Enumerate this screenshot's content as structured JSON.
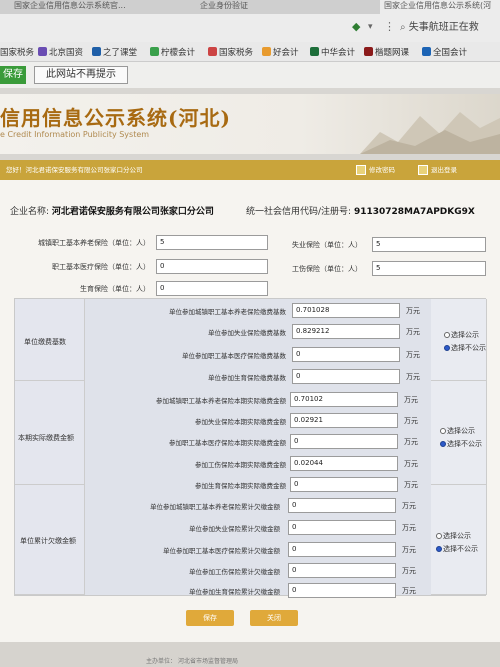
{
  "browser": {
    "tabs": [
      "国家企业信用信息公示系统官...",
      "企业身份验证",
      "国家企业信用信息公示系统(河"
    ],
    "search_text": "失事航班正在救",
    "bookmarks": [
      "国家税务",
      "北京国资",
      "之了课堂",
      "柠檬会计",
      "国家税务",
      "好会计",
      "中华会计",
      "楷题网课",
      "全国会计"
    ]
  },
  "infobar": {
    "save_label": "保存",
    "never_label": "此网站不再提示"
  },
  "site": {
    "title": "信用信息公示系统(河北)",
    "subtitle": "e Credit Information Publicity System",
    "greeting": "您好！河北君诺保安服务有限公司张家口分公司",
    "change_password": "修改密码",
    "logout": "退出登录"
  },
  "company": {
    "name_label": "企业名称:",
    "name": "河北君诺保安服务有限公司张家口分公司",
    "code_label": "统一社会信用代码/注册号:",
    "code": "91130728MA7APDKG9X"
  },
  "insured": {
    "pension_label": "城镇职工基本养老保险（单位：人）",
    "pension": "5",
    "unemployment_label": "失业保险（单位：人）",
    "unemployment": "5",
    "medical_label": "职工基本医疗保险（单位：人）",
    "medical": "0",
    "injury_label": "工伤保险（单位：人）",
    "injury": "5",
    "maternity_label": "生育保险（单位：人）",
    "maternity": "0"
  },
  "groups": {
    "base": "单位缴费基数",
    "paid": "本期实际缴费金额",
    "owed": "单位累计欠缴金额"
  },
  "rows": {
    "base": [
      {
        "label": "单位参加城镇职工基本养老保险缴费基数",
        "value": "0.701028"
      },
      {
        "label": "单位参加失业保险缴费基数",
        "value": "0.829212"
      },
      {
        "label": "单位参加职工基本医疗保险缴费基数",
        "value": "0"
      },
      {
        "label": "单位参加生育保险缴费基数",
        "value": "0"
      }
    ],
    "paid": [
      {
        "label": "参加城镇职工基本养老保险本期实际缴费金额",
        "value": "0.70102"
      },
      {
        "label": "参加失业保险本期实际缴费金额",
        "value": "0.02921"
      },
      {
        "label": "参加职工基本医疗保险本期实际缴费金额",
        "value": "0"
      },
      {
        "label": "参加工伤保险本期实际缴费金额",
        "value": "0.02044"
      },
      {
        "label": "参加生育保险本期实际缴费金额",
        "value": "0"
      }
    ],
    "owed": [
      {
        "label": "单位参加城镇职工基本养老保险累计欠缴金额",
        "value": "0"
      },
      {
        "label": "单位参加失业保险累计欠缴金额",
        "value": "0"
      },
      {
        "label": "单位参加职工基本医疗保险累计欠缴金额",
        "value": "0"
      },
      {
        "label": "单位参加工伤保险累计欠缴金额",
        "value": "0"
      },
      {
        "label": "单位参加生育保险累计欠缴金额",
        "value": "0"
      }
    ]
  },
  "unit": "万元",
  "radio": {
    "public": "选择公示",
    "nonpublic": "选择不公示"
  },
  "buttons": {
    "save": "保存",
    "close": "关闭"
  },
  "footer": {
    "left": "主办单位：",
    "right": "河北省市场监督管理局"
  }
}
